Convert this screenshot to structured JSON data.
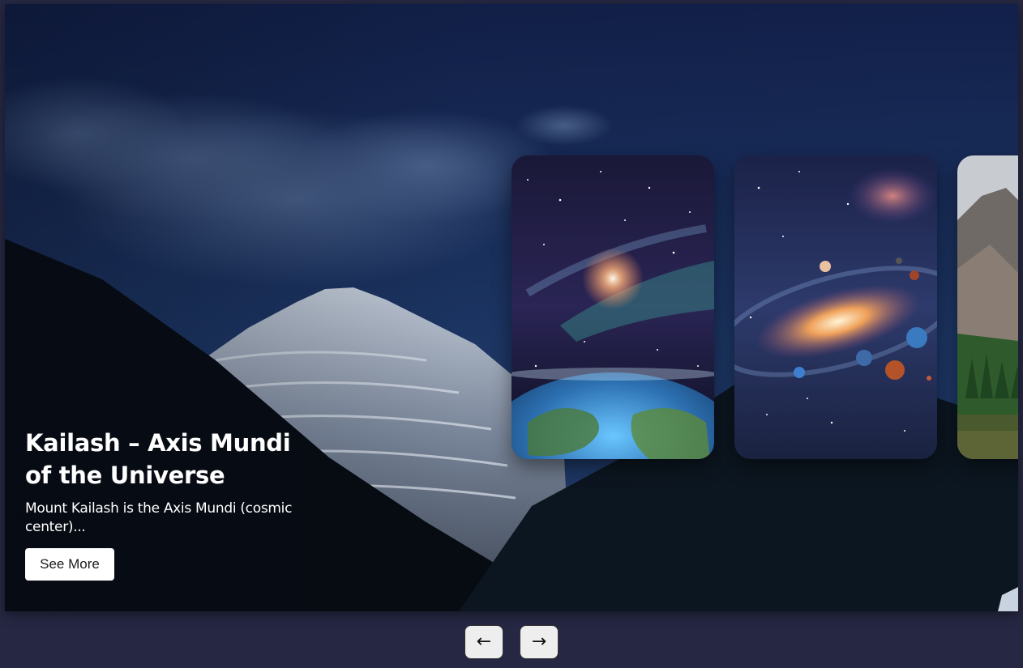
{
  "hero": {
    "title": "Kailash – Axis Mundi of the Universe",
    "description": "Mount Kailash is the Axis Mundi (cosmic center)...",
    "cta_label": "See More",
    "background_subject": "snow-capped Mount Kailash under a deep blue night sky"
  },
  "thumbnails": [
    {
      "subject": "starfield nebula above planet Earth"
    },
    {
      "subject": "spiral galaxy with planets"
    },
    {
      "subject": "rocky mountains with pine forest and lake"
    }
  ],
  "nav": {
    "prev_icon": "arrow-left-icon",
    "next_icon": "arrow-right-icon",
    "prev_glyph": "←",
    "next_glyph": "→"
  },
  "colors": {
    "page_background": "#262843",
    "sky": "#142247",
    "button_background": "#ffffff",
    "nav_button_background": "#eeeeee"
  }
}
